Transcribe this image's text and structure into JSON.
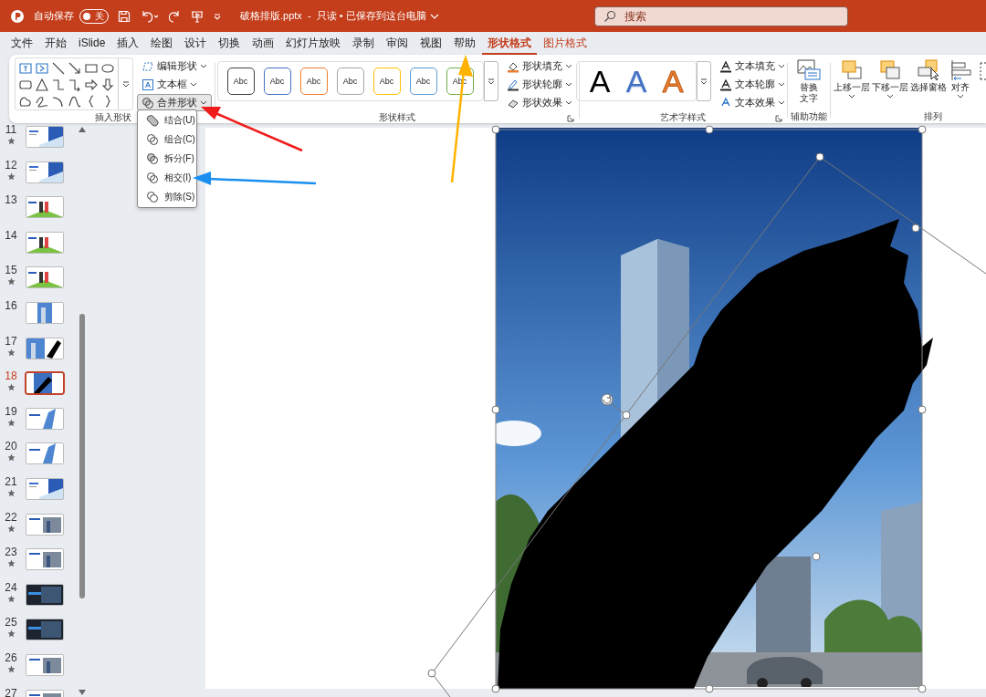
{
  "title_bar": {
    "autosave_label": "自动保存",
    "autosave_toggle": {
      "on": false,
      "label": "关"
    },
    "document_title": "破格排版.pptx  -  只读 • 已保存到这台电脑",
    "search": {
      "placeholder": "搜索"
    }
  },
  "tabs": [
    {
      "label": "文件",
      "selected": false,
      "contextual": false
    },
    {
      "label": "开始",
      "selected": false,
      "contextual": false
    },
    {
      "label": "iSlide",
      "selected": false,
      "contextual": false
    },
    {
      "label": "插入",
      "selected": false,
      "contextual": false
    },
    {
      "label": "绘图",
      "selected": false,
      "contextual": false
    },
    {
      "label": "设计",
      "selected": false,
      "contextual": false
    },
    {
      "label": "切换",
      "selected": false,
      "contextual": false
    },
    {
      "label": "动画",
      "selected": false,
      "contextual": false
    },
    {
      "label": "幻灯片放映",
      "selected": false,
      "contextual": false
    },
    {
      "label": "录制",
      "selected": false,
      "contextual": false
    },
    {
      "label": "审阅",
      "selected": false,
      "contextual": false
    },
    {
      "label": "视图",
      "selected": false,
      "contextual": false
    },
    {
      "label": "帮助",
      "selected": false,
      "contextual": false
    },
    {
      "label": "形状格式",
      "selected": true,
      "contextual": true
    },
    {
      "label": "图片格式",
      "selected": false,
      "contextual": true
    }
  ],
  "insert_shapes": {
    "label": "插入形状",
    "buttons": [
      {
        "label": "编辑形状",
        "expanded": false
      },
      {
        "label": "文本框",
        "expanded": false
      },
      {
        "label": "合并形状",
        "expanded": true
      }
    ]
  },
  "merge_menu": [
    {
      "label": "结合(U)"
    },
    {
      "label": "组合(C)"
    },
    {
      "label": "拆分(F)"
    },
    {
      "label": "相交(I)"
    },
    {
      "label": "剪除(S)"
    }
  ],
  "shape_styles": {
    "label": "形状样式",
    "swatches": [
      {
        "label": "Abc",
        "color": "#404040"
      },
      {
        "label": "Abc",
        "color": "#4472c4"
      },
      {
        "label": "Abc",
        "color": "#ed7d31"
      },
      {
        "label": "Abc",
        "color": "#a5a5a5"
      },
      {
        "label": "Abc",
        "color": "#ffc000"
      },
      {
        "label": "Abc",
        "color": "#5b9bd5"
      },
      {
        "label": "Abc",
        "color": "#70ad47"
      }
    ],
    "buttons": [
      "形状填充",
      "形状轮廓",
      "形状效果"
    ]
  },
  "wordart_styles": {
    "label": "艺术字样式",
    "samples": [
      {
        "label": "A",
        "color": "#000000"
      },
      {
        "label": "A",
        "color": "#4472c4"
      },
      {
        "label": "A",
        "color": "#ed7d31"
      }
    ],
    "buttons": [
      "文本填充",
      "文本轮廓",
      "文本效果"
    ]
  },
  "accessibility": {
    "label": "辅助功能",
    "button": "替换文字"
  },
  "arrange": {
    "label": "排列",
    "buttons": [
      "上移一层",
      "下移一层",
      "选择窗格",
      "对齐"
    ]
  },
  "slides": [
    {
      "number": "11",
      "starred": true,
      "selected": false
    },
    {
      "number": "12",
      "starred": true,
      "selected": false
    },
    {
      "number": "13",
      "starred": false,
      "selected": false
    },
    {
      "number": "14",
      "starred": false,
      "selected": false
    },
    {
      "number": "15",
      "starred": true,
      "selected": false
    },
    {
      "number": "16",
      "starred": false,
      "selected": false
    },
    {
      "number": "17",
      "starred": true,
      "selected": false
    },
    {
      "number": "18",
      "starred": true,
      "selected": true
    },
    {
      "number": "19",
      "starred": true,
      "selected": false
    },
    {
      "number": "20",
      "starred": true,
      "selected": false
    },
    {
      "number": "21",
      "starred": true,
      "selected": false
    },
    {
      "number": "22",
      "starred": true,
      "selected": false
    },
    {
      "number": "23",
      "starred": true,
      "selected": false
    },
    {
      "number": "24",
      "starred": true,
      "selected": false
    },
    {
      "number": "25",
      "starred": true,
      "selected": false
    },
    {
      "number": "26",
      "starred": true,
      "selected": false
    },
    {
      "number": "27",
      "starred": false,
      "selected": false
    }
  ]
}
